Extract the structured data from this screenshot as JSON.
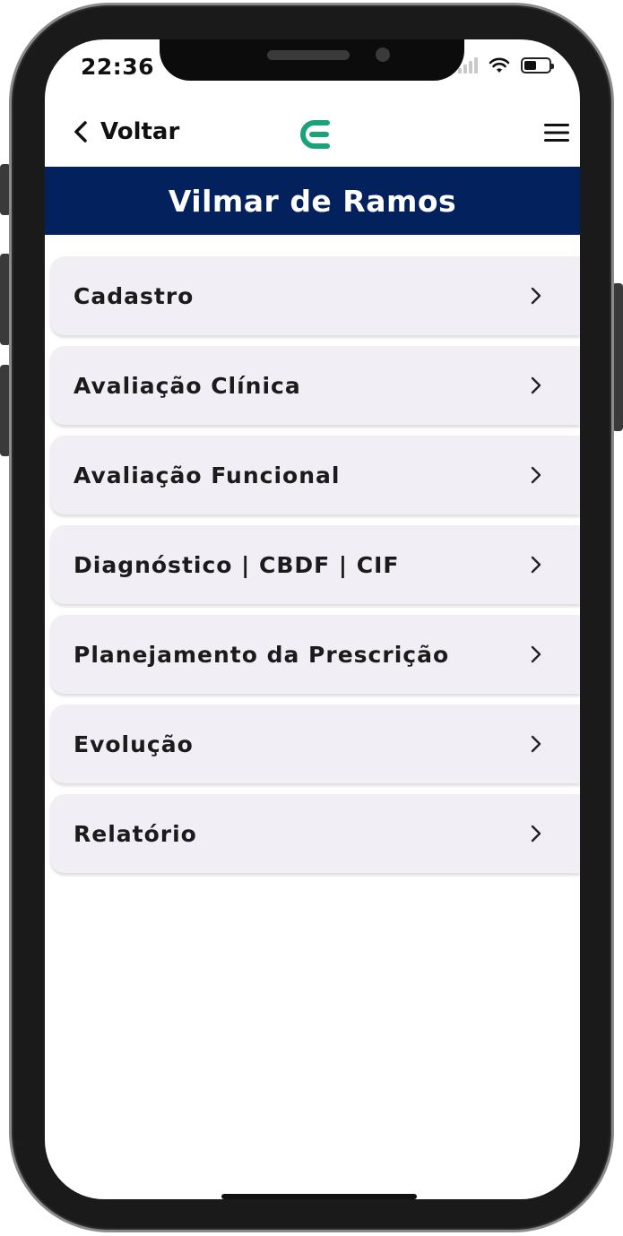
{
  "status_bar": {
    "time": "22:36"
  },
  "nav": {
    "back_label": "Voltar",
    "back_icon": "chevron-left-icon",
    "logo_icon": "brand-logo-icon",
    "menu_icon": "hamburger-menu-icon"
  },
  "header": {
    "title": "Vilmar de Ramos"
  },
  "menu": {
    "items": [
      {
        "label": "Cadastro"
      },
      {
        "label": "Avaliação Clínica"
      },
      {
        "label": "Avaliação Funcional"
      },
      {
        "label": "Diagnóstico | CBDF | CIF"
      },
      {
        "label": "Planejamento da Prescrição"
      },
      {
        "label": "Evolução"
      },
      {
        "label": "Relatório"
      }
    ]
  },
  "colors": {
    "banner": "#03215c",
    "logo": "#1aa37a",
    "item_background": "#f1eef5"
  }
}
